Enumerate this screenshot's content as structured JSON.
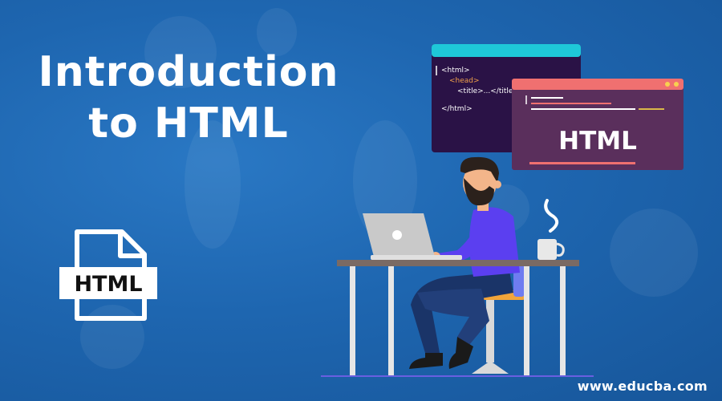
{
  "banner": {
    "title_line1": "Introduction",
    "title_line2": "to HTML"
  },
  "file_icon": {
    "label": "HTML"
  },
  "code_window": {
    "header_color": "#1ec8d8",
    "lines": [
      "<html>",
      "<head>",
      "<title>...</title>",
      "</html>"
    ]
  },
  "preview_window": {
    "header_color": "#f07070",
    "heading": "HTML"
  },
  "footer": {
    "url": "www.educba.com"
  },
  "colors": {
    "background": "#1e66b0",
    "shirt": "#5b3ff0",
    "pants": "#1a3468",
    "seat": "#f2a53a",
    "desk": "#7a6a64"
  }
}
